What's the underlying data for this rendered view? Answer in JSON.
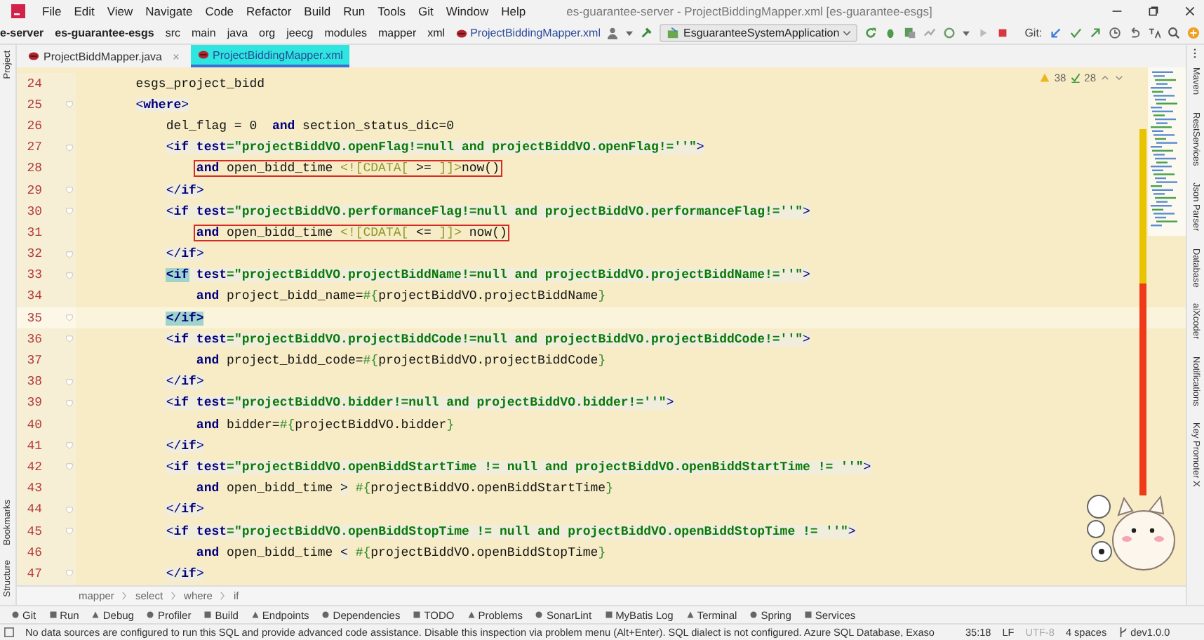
{
  "window": {
    "title": "es-guarantee-server - ProjectBiddingMapper.xml [es-guarantee-esgs]"
  },
  "menu": [
    "File",
    "Edit",
    "View",
    "Navigate",
    "Code",
    "Refactor",
    "Build",
    "Run",
    "Tools",
    "Git",
    "Window",
    "Help"
  ],
  "navigation_bar": {
    "path": [
      {
        "label": "e-server",
        "kind": "module"
      },
      {
        "label": "es-guarantee-esgs",
        "kind": "module"
      },
      {
        "label": "src",
        "kind": "dir"
      },
      {
        "label": "main",
        "kind": "dir"
      },
      {
        "label": "java",
        "kind": "dir"
      },
      {
        "label": "org",
        "kind": "dir"
      },
      {
        "label": "jeecg",
        "kind": "dir"
      },
      {
        "label": "modules",
        "kind": "dir"
      },
      {
        "label": "mapper",
        "kind": "dir"
      },
      {
        "label": "xml",
        "kind": "dir"
      },
      {
        "label": "ProjectBiddingMapper.xml",
        "kind": "file"
      }
    ],
    "run_configuration": "EsguaranteeSystemApplication",
    "git_label": "Git:"
  },
  "left_tool_tabs": [
    {
      "label": "Project",
      "kind": "top"
    },
    {
      "label": "Bookmarks",
      "kind": "bottom"
    },
    {
      "label": "Structure",
      "kind": "bottom"
    }
  ],
  "tabs": [
    {
      "label": "ProjectBiddMapper.java",
      "selected": false
    },
    {
      "label": "ProjectBiddingMapper.xml",
      "selected": true
    }
  ],
  "inspections": {
    "warnings": "38",
    "weak_warnings": "28"
  },
  "lines": [
    {
      "number": "24",
      "current": false,
      "boxed": false,
      "fold": false,
      "segments": [
        {
          "kind": "txt",
          "text": "        esgs_project_bidd"
        }
      ]
    },
    {
      "number": "25",
      "current": false,
      "boxed": false,
      "fold": true,
      "segments": [
        {
          "kind": "br",
          "text": "        <"
        },
        {
          "kind": "tag",
          "text": "where"
        },
        {
          "kind": "br",
          "text": ">"
        }
      ]
    },
    {
      "number": "26",
      "current": false,
      "boxed": false,
      "fold": false,
      "segments": [
        {
          "kind": "txt",
          "text": "            del_flag = 0  "
        },
        {
          "kind": "kw",
          "text": "and"
        },
        {
          "kind": "txt",
          "text": " section_status_dic=0"
        }
      ]
    },
    {
      "number": "27",
      "current": false,
      "boxed": false,
      "fold": true,
      "segments": [
        {
          "kind": "br",
          "text": "            <"
        },
        {
          "kind": "tag",
          "text": "if"
        },
        {
          "kind": "attr",
          "text": " test"
        },
        {
          "kind": "str",
          "text": "=\"projectBiddVO.openFlag!=null and projectBiddVO.openFlag!=''\""
        },
        {
          "kind": "br",
          "text": ">"
        }
      ]
    },
    {
      "number": "28",
      "current": false,
      "boxed": true,
      "fold": false,
      "segments": [
        {
          "kind": "kw",
          "text": "                and"
        },
        {
          "kind": "txt",
          "text": " open_bidd_time "
        },
        {
          "kind": "cdata",
          "text": "<![CDATA["
        },
        {
          "kind": "txt",
          "text": " >= "
        },
        {
          "kind": "cdata",
          "text": "]]>"
        },
        {
          "kind": "txt",
          "text": "now()"
        }
      ]
    },
    {
      "number": "29",
      "current": false,
      "boxed": false,
      "fold": true,
      "segments": [
        {
          "kind": "br",
          "text": "            </"
        },
        {
          "kind": "tag",
          "text": "if"
        },
        {
          "kind": "br",
          "text": ">"
        }
      ]
    },
    {
      "number": "30",
      "current": false,
      "boxed": false,
      "fold": true,
      "segments": [
        {
          "kind": "br",
          "text": "            <"
        },
        {
          "kind": "tag",
          "text": "if"
        },
        {
          "kind": "attr",
          "text": " test"
        },
        {
          "kind": "str",
          "text": "=\"projectBiddVO.performanceFlag!=null and projectBiddVO.performanceFlag!=''\""
        },
        {
          "kind": "br",
          "text": ">"
        }
      ]
    },
    {
      "number": "31",
      "current": false,
      "boxed": true,
      "fold": false,
      "segments": [
        {
          "kind": "kw",
          "text": "                and"
        },
        {
          "kind": "txt",
          "text": " open_bidd_time "
        },
        {
          "kind": "cdata",
          "text": "<![CDATA["
        },
        {
          "kind": "txt",
          "text": " <= "
        },
        {
          "kind": "cdata",
          "text": "]]>"
        },
        {
          "kind": "txt",
          "text": " now()"
        }
      ]
    },
    {
      "number": "32",
      "current": false,
      "boxed": false,
      "fold": true,
      "segments": [
        {
          "kind": "br",
          "text": "            </"
        },
        {
          "kind": "tag",
          "text": "if"
        },
        {
          "kind": "br",
          "text": ">"
        }
      ]
    },
    {
      "number": "33",
      "current": false,
      "boxed": false,
      "fold": true,
      "segments": [
        {
          "kind": "match",
          "text": "            <if"
        },
        {
          "kind": "attr",
          "text": " test"
        },
        {
          "kind": "str",
          "text": "=\"projectBiddVO.projectBiddName!=null and projectBiddVO.projectBiddName!=''\""
        },
        {
          "kind": "br",
          "text": ">"
        }
      ]
    },
    {
      "number": "34",
      "current": false,
      "boxed": false,
      "fold": false,
      "segments": [
        {
          "kind": "kw",
          "text": "                and"
        },
        {
          "kind": "txt",
          "text": " project_bidd_name="
        },
        {
          "kind": "brace",
          "text": "#{"
        },
        {
          "kind": "txt",
          "text": "projectBiddVO.projectBiddName"
        },
        {
          "kind": "brace",
          "text": "}"
        }
      ]
    },
    {
      "number": "35",
      "current": true,
      "boxed": false,
      "fold": true,
      "segments": [
        {
          "kind": "match",
          "text": "            </if>"
        }
      ]
    },
    {
      "number": "36",
      "current": false,
      "boxed": false,
      "fold": true,
      "segments": [
        {
          "kind": "br",
          "text": "            <"
        },
        {
          "kind": "tag",
          "text": "if"
        },
        {
          "kind": "attr",
          "text": " test"
        },
        {
          "kind": "str",
          "text": "=\"projectBiddVO.projectBiddCode!=null and projectBiddVO.projectBiddCode!=''\""
        },
        {
          "kind": "br",
          "text": ">"
        }
      ]
    },
    {
      "number": "37",
      "current": false,
      "boxed": false,
      "fold": false,
      "segments": [
        {
          "kind": "kw",
          "text": "                and"
        },
        {
          "kind": "txt",
          "text": " project_bidd_code="
        },
        {
          "kind": "brace",
          "text": "#{"
        },
        {
          "kind": "txt",
          "text": "projectBiddVO.projectBiddCode"
        },
        {
          "kind": "brace",
          "text": "}"
        }
      ]
    },
    {
      "number": "38",
      "current": false,
      "boxed": false,
      "fold": true,
      "segments": [
        {
          "kind": "br",
          "text": "            </"
        },
        {
          "kind": "tag",
          "text": "if"
        },
        {
          "kind": "br",
          "text": ">"
        }
      ]
    },
    {
      "number": "39",
      "current": false,
      "boxed": false,
      "fold": true,
      "segments": [
        {
          "kind": "br",
          "text": "            <"
        },
        {
          "kind": "tag",
          "text": "if"
        },
        {
          "kind": "attr",
          "text": " test"
        },
        {
          "kind": "str",
          "text": "=\"projectBiddVO.bidder!=null and projectBiddVO.bidder!=''\""
        },
        {
          "kind": "br",
          "text": ">"
        }
      ]
    },
    {
      "number": "40",
      "current": false,
      "boxed": false,
      "fold": false,
      "segments": [
        {
          "kind": "kw",
          "text": "                and"
        },
        {
          "kind": "txt",
          "text": " bidder="
        },
        {
          "kind": "brace",
          "text": "#{"
        },
        {
          "kind": "txt",
          "text": "projectBiddVO.bidder"
        },
        {
          "kind": "brace",
          "text": "}"
        }
      ]
    },
    {
      "number": "41",
      "current": false,
      "boxed": false,
      "fold": true,
      "segments": [
        {
          "kind": "br",
          "text": "            </"
        },
        {
          "kind": "tag",
          "text": "if"
        },
        {
          "kind": "br",
          "text": ">"
        }
      ]
    },
    {
      "number": "42",
      "current": false,
      "boxed": false,
      "fold": true,
      "segments": [
        {
          "kind": "br",
          "text": "            <"
        },
        {
          "kind": "tag",
          "text": "if"
        },
        {
          "kind": "attr",
          "text": " test"
        },
        {
          "kind": "str",
          "text": "=\"projectBiddVO.openBiddStartTime != null and projectBiddVO.openBiddStartTime != ''\""
        },
        {
          "kind": "br",
          "text": ">"
        }
      ]
    },
    {
      "number": "43",
      "current": false,
      "boxed": false,
      "fold": false,
      "segments": [
        {
          "kind": "kw",
          "text": "                and"
        },
        {
          "kind": "txt",
          "text": " open_bidd_time "
        },
        {
          "kind": "ent",
          "text": ">"
        },
        {
          "kind": "brace",
          "text": " #{"
        },
        {
          "kind": "txt",
          "text": "projectBiddVO.openBiddStartTime"
        },
        {
          "kind": "brace",
          "text": "}"
        }
      ]
    },
    {
      "number": "44",
      "current": false,
      "boxed": false,
      "fold": true,
      "segments": [
        {
          "kind": "br",
          "text": "            </"
        },
        {
          "kind": "tag",
          "text": "if"
        },
        {
          "kind": "br",
          "text": ">"
        }
      ]
    },
    {
      "number": "45",
      "current": false,
      "boxed": false,
      "fold": true,
      "segments": [
        {
          "kind": "br",
          "text": "            <"
        },
        {
          "kind": "tag",
          "text": "if"
        },
        {
          "kind": "attr",
          "text": " test"
        },
        {
          "kind": "str",
          "text": "=\"projectBiddVO.openBiddStopTime != null and projectBiddVO.openBiddStopTime != ''\""
        },
        {
          "kind": "br",
          "text": ">"
        }
      ]
    },
    {
      "number": "46",
      "current": false,
      "boxed": false,
      "fold": false,
      "segments": [
        {
          "kind": "kw",
          "text": "                and"
        },
        {
          "kind": "txt",
          "text": " open_bidd_time "
        },
        {
          "kind": "ent",
          "text": "<"
        },
        {
          "kind": "brace",
          "text": " #{"
        },
        {
          "kind": "txt",
          "text": "projectBiddVO.openBiddStopTime"
        },
        {
          "kind": "brace",
          "text": "}"
        }
      ]
    },
    {
      "number": "47",
      "current": false,
      "boxed": false,
      "fold": true,
      "segments": [
        {
          "kind": "br",
          "text": "            </"
        },
        {
          "kind": "tag",
          "text": "if"
        },
        {
          "kind": "br",
          "text": ">"
        }
      ]
    }
  ],
  "breadcrumb": [
    "mapper",
    "select",
    "where",
    "if"
  ],
  "right_tool_tabs": [
    "Maven",
    "RestServices",
    "Json Parser",
    "Database",
    "aiXcoder",
    "Notifications",
    "Key Promoter X"
  ],
  "tool_windows": [
    "Git",
    "Run",
    "Debug",
    "Profiler",
    "Build",
    "Endpoints",
    "Dependencies",
    "TODO",
    "Problems",
    "SonarLint",
    "MyBatis Log",
    "Terminal",
    "Spring",
    "Services"
  ],
  "status_bar": {
    "message": "No data sources are configured to run this SQL and provide advanced code assistance. Disable this inspection via problem menu (Alt+Enter). SQL dialect is not configured. Azure SQL Database, Exaso",
    "position": "35:18",
    "line_separator": "LF",
    "encoding": "UTF-8",
    "encoding_disabled": true,
    "indent": "4 spaces",
    "branch": "dev1.0.0"
  }
}
